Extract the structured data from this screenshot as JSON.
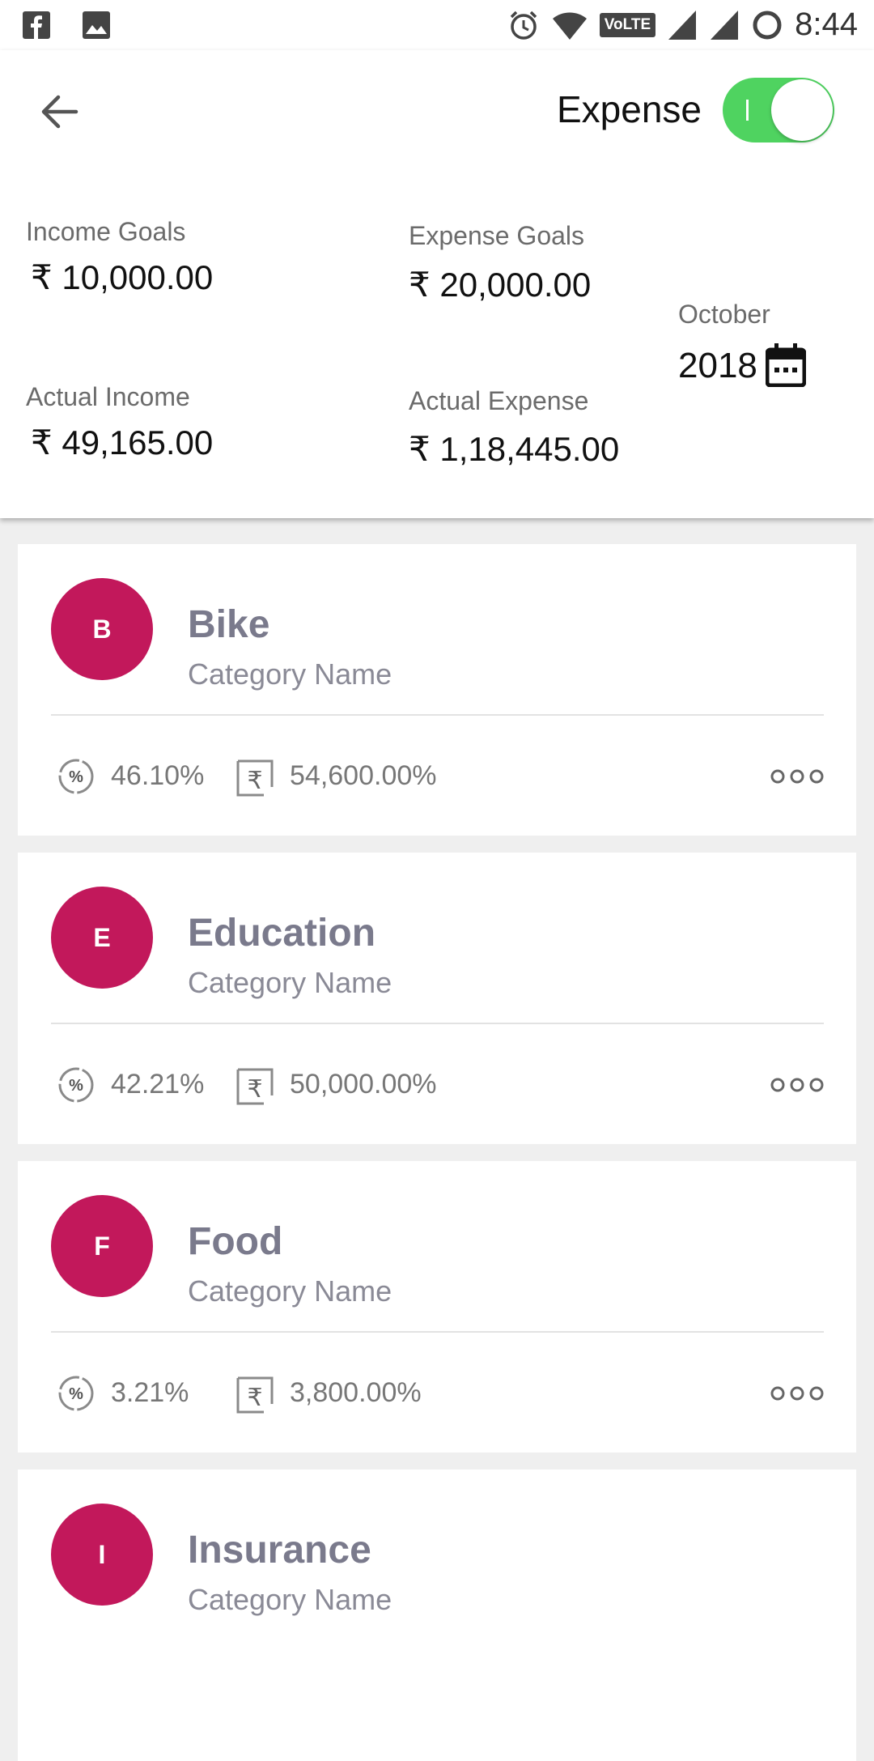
{
  "status_bar": {
    "time": "8:44",
    "left_icons": [
      "facebook-icon",
      "gallery-icon"
    ],
    "right_icons": [
      "alarm-icon",
      "wifi-icon",
      "volte-icon",
      "signal-icon",
      "signal-icon",
      "loading-icon"
    ],
    "volte_text": "VoLTE"
  },
  "header": {
    "mode_label": "Expense",
    "toggle_on": true,
    "toggle_color": "#4fd360",
    "income_goals_label": "Income Goals",
    "income_goals_value": "₹ 10,000.00",
    "expense_goals_label": "Expense Goals",
    "expense_goals_value": "₹ 20,000.00",
    "actual_income_label": "Actual Income",
    "actual_income_value": "₹ 49,165.00",
    "actual_expense_label": "Actual Expense",
    "actual_expense_value": "₹ 1,18,445.00",
    "month": "October",
    "year": "2018"
  },
  "accent_color": "#c2185b",
  "categories": [
    {
      "initial": "B",
      "name": "Bike",
      "subtitle": "Category Name",
      "percent": "46.10%",
      "amount": "54,600.00%"
    },
    {
      "initial": "E",
      "name": "Education",
      "subtitle": "Category Name",
      "percent": "42.21%",
      "amount": "50,000.00%"
    },
    {
      "initial": "F",
      "name": "Food",
      "subtitle": "Category Name",
      "percent": "3.21%",
      "amount": "3,800.00%"
    },
    {
      "initial": "I",
      "name": "Insurance",
      "subtitle": "Category Name",
      "percent": "",
      "amount": ""
    }
  ]
}
